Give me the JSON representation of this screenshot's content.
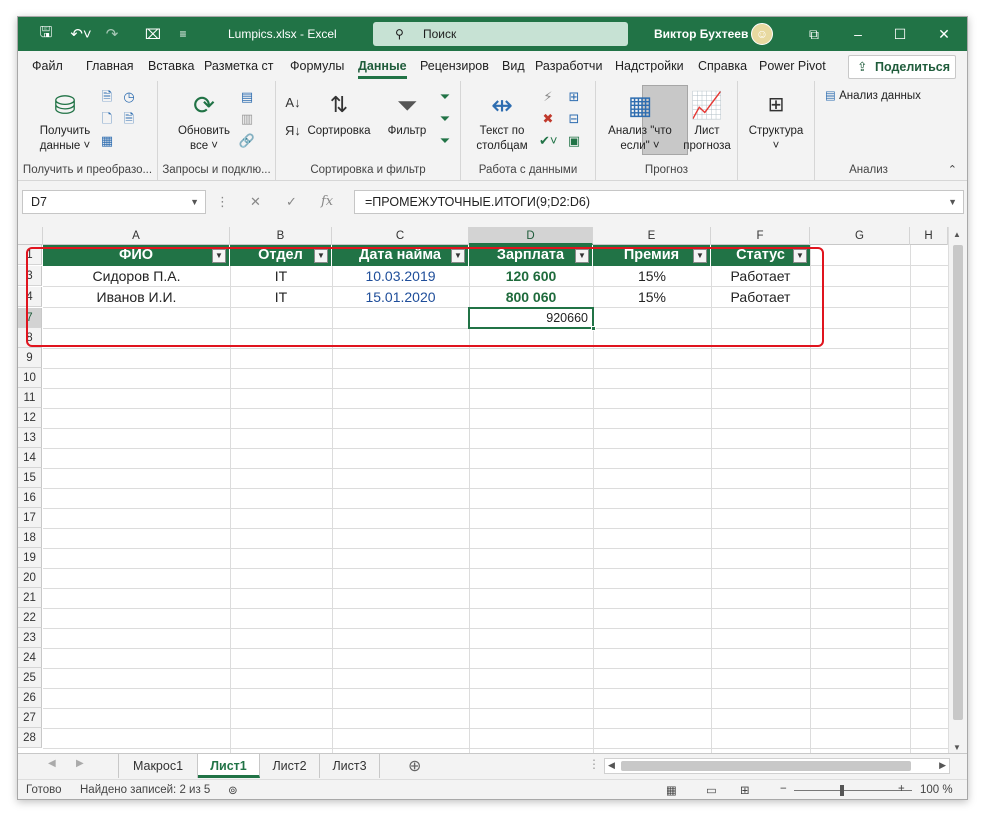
{
  "window": {
    "title": "Lumpics.xlsx  -  Excel",
    "search_placeholder": "Поиск",
    "user_name": "Виктор Бухтеев",
    "min_label": "–",
    "max_label": "☐",
    "close_label": "✕"
  },
  "tabs": [
    {
      "label": "Файл"
    },
    {
      "label": "Главная"
    },
    {
      "label": "Вставка"
    },
    {
      "label": "Разметка ст"
    },
    {
      "label": "Формулы"
    },
    {
      "label": "Данные",
      "active": true
    },
    {
      "label": "Рецензиров"
    },
    {
      "label": "Вид"
    },
    {
      "label": "Разработчи"
    },
    {
      "label": "Надстройки"
    },
    {
      "label": "Справка"
    },
    {
      "label": "Power Pivot"
    }
  ],
  "share_label": "Поделиться",
  "ribbon": {
    "groups": {
      "get_data": "Получить и преобразо...",
      "queries": "Запросы и подклю...",
      "sort_filter": "Сортировка и фильтр",
      "data_tools": "Работа с данными",
      "forecast": "Прогноз",
      "analysis": "Анализ"
    },
    "get_data_label_1": "Получить",
    "get_data_label_2": "данные ˅",
    "refresh_label_1": "Обновить",
    "refresh_label_2": "все ˅",
    "sort_label": "Сортировка",
    "filter_label": "Фильтр",
    "text_to_cols_1": "Текст по",
    "text_to_cols_2": "столбцам",
    "whatif_1": "Анализ \"что",
    "whatif_2": "если\" ˅",
    "forecast_1": "Лист",
    "forecast_2": "прогноза",
    "outline_1": "Структура",
    "outline_2": "˅",
    "data_analysis": "Анализ данных"
  },
  "formula_bar": {
    "name_box": "D7",
    "formula": "=ПРОМЕЖУТОЧНЫЕ.ИТОГИ(9;D2:D6)",
    "fx": "fx"
  },
  "columns": [
    "A",
    "B",
    "C",
    "D",
    "E",
    "F",
    "G",
    "H"
  ],
  "row_numbers": [
    "1",
    "3",
    "4",
    "7",
    "8",
    "9",
    "10",
    "11",
    "12",
    "13",
    "14",
    "15",
    "16",
    "17",
    "18",
    "19",
    "20",
    "21",
    "22",
    "23",
    "24",
    "25",
    "26",
    "27",
    "28"
  ],
  "table": {
    "headers": [
      "ФИО",
      "Отдел",
      "Дата найма",
      "Зарплата",
      "Премия",
      "Статус"
    ],
    "rows": [
      [
        "Сидоров П.А.",
        "IT",
        "10.03.2019",
        "120 600",
        "15%",
        "Работает"
      ],
      [
        "Иванов И.И.",
        "IT",
        "15.01.2020",
        "800 060",
        "15%",
        "Работает"
      ]
    ],
    "total": "920660"
  },
  "sheets": [
    "Макрос1",
    "Лист1",
    "Лист2",
    "Лист3"
  ],
  "active_sheet": "Лист1",
  "status": {
    "ready": "Готово",
    "found": "Найдено записей: 2 из 5",
    "zoom": "100 %"
  },
  "colors": {
    "accent": "#217346",
    "highlight": "#e0141e",
    "date": "#1f4e9a"
  }
}
